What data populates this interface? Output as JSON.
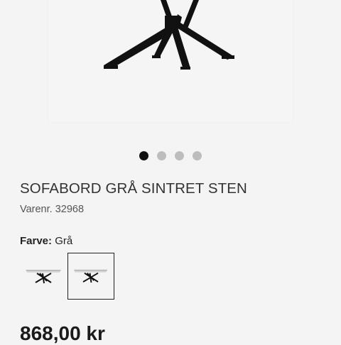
{
  "product": {
    "title": "SOFABORD GRÅ SINTRET STEN",
    "sku_label": "Varenr. 32968"
  },
  "carousel": {
    "slide_count": 4,
    "active_index": 0
  },
  "color": {
    "label": "Farve:",
    "value": "Grå",
    "swatches": [
      {
        "icon": "table-thumbnail-icon",
        "selected": false
      },
      {
        "icon": "table-thumbnail-icon",
        "selected": true
      }
    ]
  },
  "price": {
    "text": "868,00 kr"
  },
  "colors": {
    "accent": "#111111",
    "dot_inactive": "#bdbdbd",
    "background": "#f4f4f4"
  }
}
